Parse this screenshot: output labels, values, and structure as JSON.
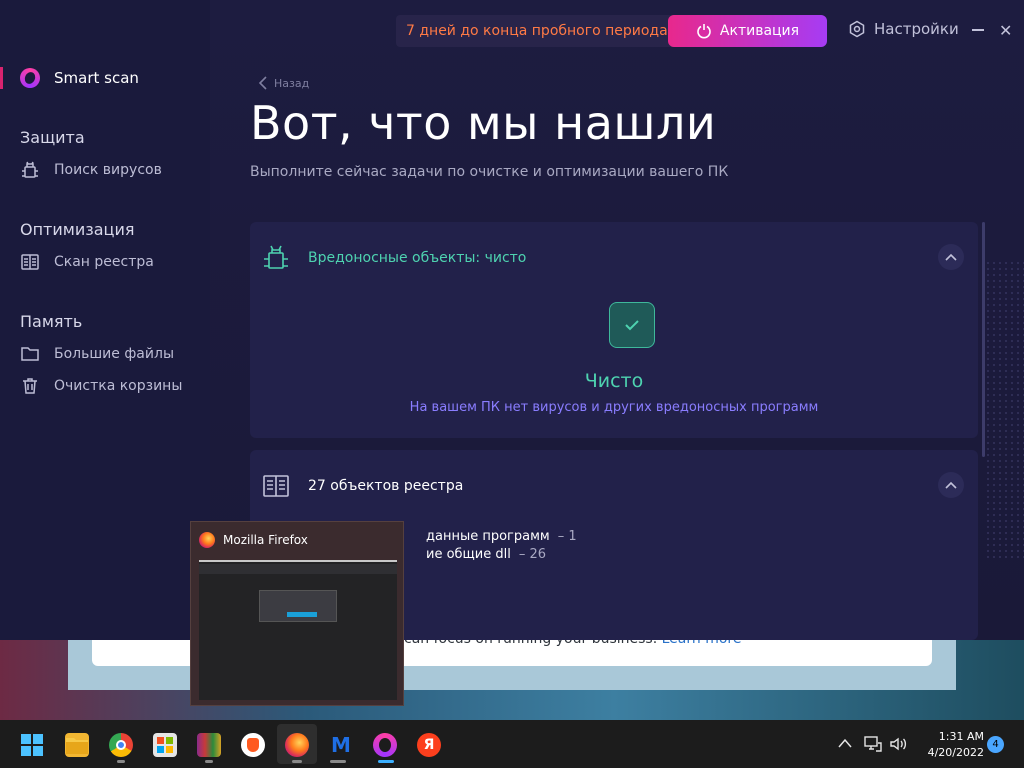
{
  "sidebar": {
    "smart_scan": "Smart scan",
    "sections": [
      {
        "title": "Защита",
        "items": [
          {
            "label": "Поиск вирусов",
            "icon": "bug-icon"
          }
        ]
      },
      {
        "title": "Оптимизация",
        "items": [
          {
            "label": "Скан реестра",
            "icon": "registry-icon"
          }
        ]
      },
      {
        "title": "Память",
        "items": [
          {
            "label": "Большие файлы",
            "icon": "folder-icon"
          },
          {
            "label": "Очистка корзины",
            "icon": "trash-icon"
          }
        ]
      }
    ]
  },
  "topbar": {
    "trial_text": "7 дней до конца пробного периода",
    "activate_label": "Активация",
    "settings_label": "Настройки"
  },
  "main": {
    "back_label": "Назад",
    "title": "Вот, что мы нашли",
    "subtitle": "Выполните сейчас задачи по очистке и оптимизации вашего ПК",
    "malware_card": {
      "header": "Вредоносные объекты: чисто",
      "status_title": "Чисто",
      "status_text": "На вашем ПК нет вирусов и других вредоносных программ"
    },
    "registry_card": {
      "header": "27 объектов реестра",
      "lines": [
        {
          "text": "данные программ",
          "count": "– 1"
        },
        {
          "text": "ие общие dll",
          "count": "– 26"
        }
      ]
    }
  },
  "background_window": {
    "text": "can focus on running your business.",
    "link": "Learn more"
  },
  "preview": {
    "title": "Mozilla Firefox"
  },
  "taskbar": {
    "time": "1:31 AM",
    "date": "4/20/2022",
    "notifications": "4",
    "apps": [
      "start",
      "file-explorer",
      "chrome",
      "store",
      "winrar",
      "brave",
      "firefox",
      "malwarebytes",
      "opera-antivirus",
      "yandex"
    ]
  },
  "colors": {
    "accent_pink": "#e8288c",
    "accent_purple": "#a63cf4",
    "clean_green": "#4ed3b0",
    "trial_orange": "#ff7a45"
  }
}
